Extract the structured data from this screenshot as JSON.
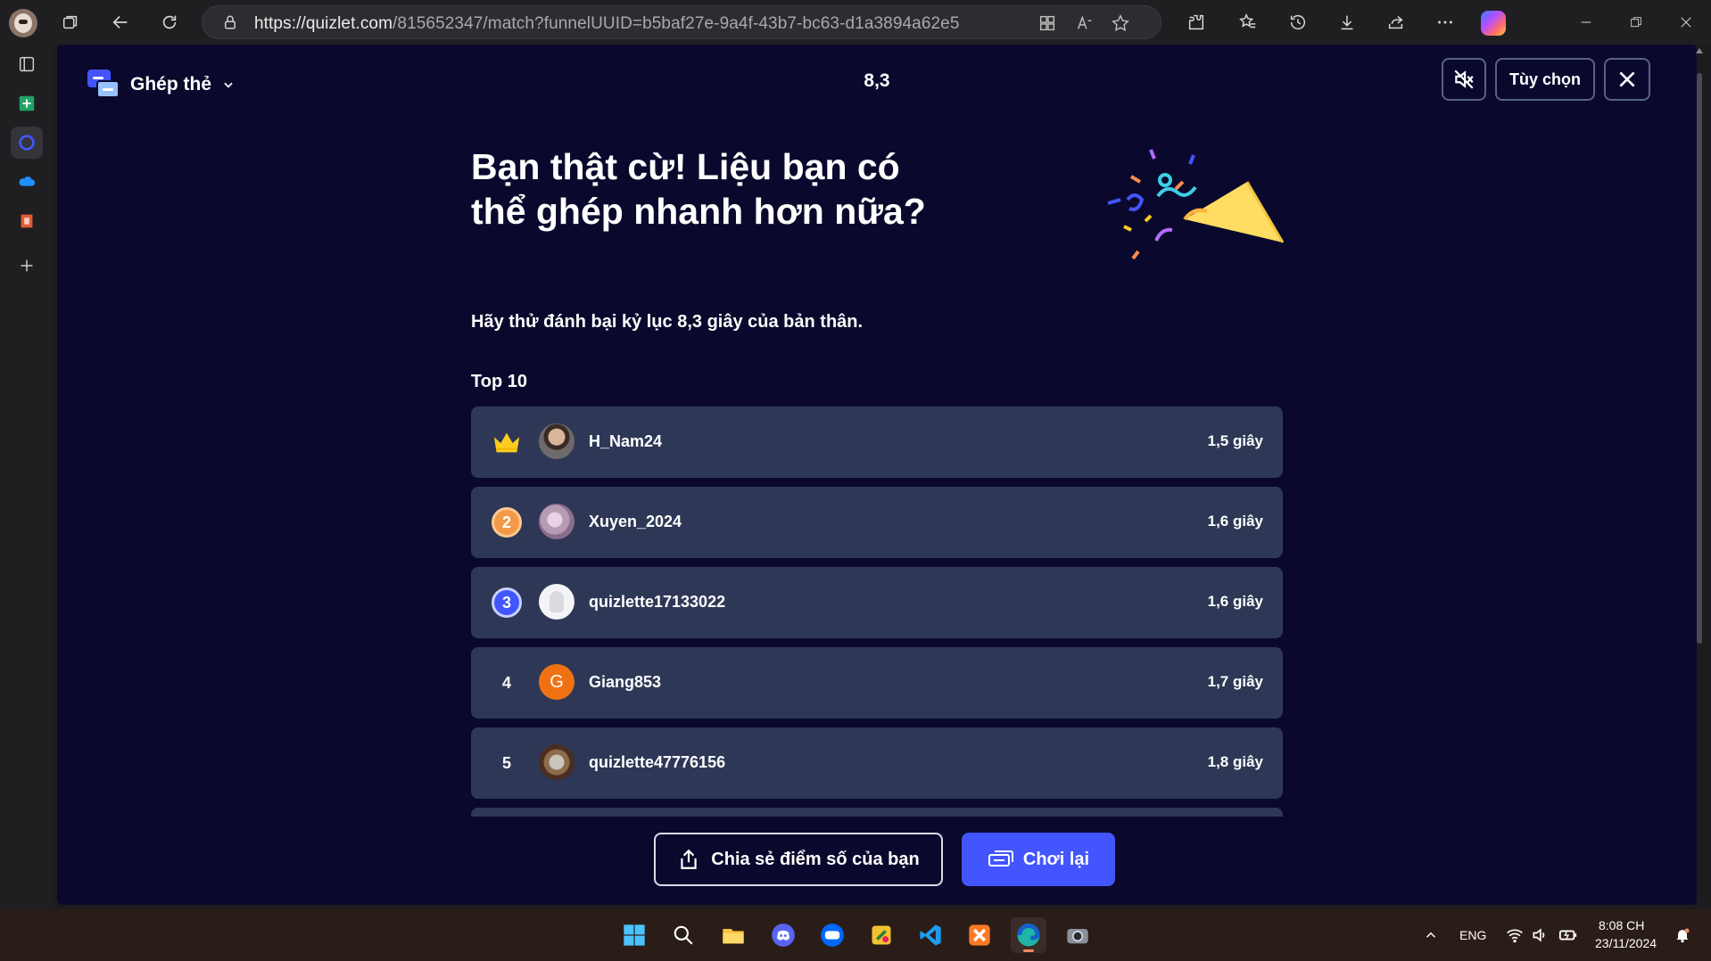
{
  "browser": {
    "url_host": "https://quizlet.com",
    "url_path": "/815652347/match?funnelUUID=b5baf27e-9a4f-43b7-bc63-d1a3894a62e5"
  },
  "header": {
    "mode_title": "Ghép thẻ",
    "timer": "8,3",
    "options_label": "Tùy chọn"
  },
  "result": {
    "headline": "Bạn thật cừ! Liệu bạn có thể ghép nhanh hơn nữa?",
    "subtitle_prefix": "Hãy thử đánh bại kỷ lục ",
    "subtitle_record": "8,3 giây",
    "subtitle_suffix": " của bản thân.",
    "top_label": "Top 10"
  },
  "leaderboard": [
    {
      "rank": "1",
      "name": "H_Nam24",
      "time": "1,5 giây",
      "avatar": "photo1"
    },
    {
      "rank": "2",
      "name": "Xuyen_2024",
      "time": "1,6 giây",
      "avatar": "photo2"
    },
    {
      "rank": "3",
      "name": "quizlette17133022",
      "time": "1,6 giây",
      "avatar": "default"
    },
    {
      "rank": "4",
      "name": "Giang853",
      "time": "1,7 giây",
      "avatar": "letter",
      "avatar_letter": "G"
    },
    {
      "rank": "5",
      "name": "quizlette47776156",
      "time": "1,8 giây",
      "avatar": "photo3"
    }
  ],
  "actions": {
    "share_label": "Chia sẻ điểm số của bạn",
    "play_again_label": "Chơi lại"
  },
  "taskbar": {
    "lang": "ENG",
    "time": "8:08 CH",
    "date": "23/11/2024"
  },
  "colors": {
    "page_bg": "#0a092d",
    "row_bg": "#2e3856",
    "accent": "#4255ff",
    "crown": "#ffcd1f"
  }
}
